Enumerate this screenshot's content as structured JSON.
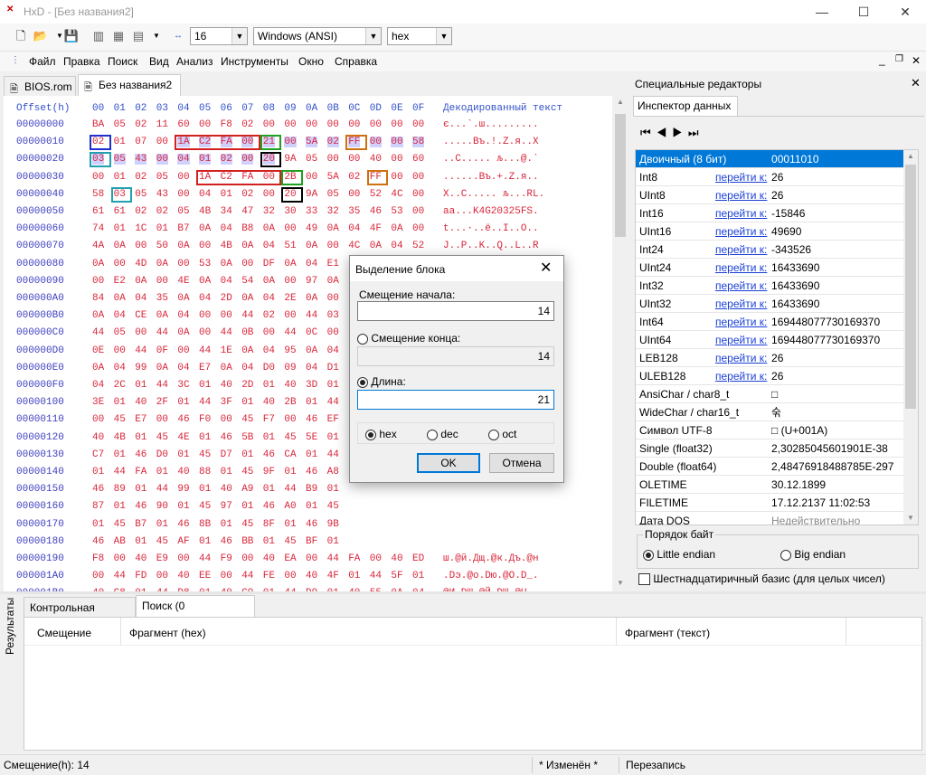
{
  "window": {
    "title": "HxD - [Без названия2]",
    "logo": "HxD",
    "minimize": "—",
    "maximize": "☐",
    "close": "✕"
  },
  "toolbar": {
    "bytes_per_row": "16",
    "charset": "Windows (ANSI)",
    "offset_base": "hex",
    "icons": [
      "new-icon",
      "open-icon",
      "save-icon",
      "close-file-icon",
      "ram-icon",
      "disk-icon",
      "bytes-per-row-icon"
    ]
  },
  "menu": [
    "Файл",
    "Правка",
    "Поиск",
    "Вид",
    "Анализ",
    "Инструменты",
    "Окно",
    "Справка"
  ],
  "mdi_controls": [
    "_",
    "❐",
    "✕"
  ],
  "tabs": [
    {
      "label": "BIOS.rom"
    },
    {
      "label": "Без названия2"
    }
  ],
  "hex": {
    "header_offset": "Offset(h)",
    "columns": [
      "00",
      "01",
      "02",
      "03",
      "04",
      "05",
      "06",
      "07",
      "08",
      "09",
      "0A",
      "0B",
      "0C",
      "0D",
      "0E",
      "0F"
    ],
    "header_text": "Декодированный текст",
    "rows": [
      {
        "o": "00000000",
        "b": [
          "BA",
          "05",
          "02",
          "11",
          "60",
          "00",
          "F8",
          "02",
          "00",
          "00",
          "00",
          "00",
          "00",
          "00",
          "00",
          "00"
        ],
        "t": "є...`.ш........."
      },
      {
        "o": "00000010",
        "b": [
          "02",
          "01",
          "07",
          "00",
          "1A",
          "C2",
          "FA",
          "00",
          "21",
          "00",
          "5A",
          "02",
          "FF",
          "00",
          "00",
          "58"
        ],
        "t": ".....Въ.!.Z.я..X"
      },
      {
        "o": "00000020",
        "b": [
          "03",
          "05",
          "43",
          "00",
          "04",
          "01",
          "02",
          "00",
          "20",
          "9A",
          "05",
          "00",
          "00",
          "40",
          "00",
          "60"
        ],
        "t": "..C..... љ...@.`"
      },
      {
        "o": "00000030",
        "b": [
          "00",
          "01",
          "02",
          "05",
          "00",
          "1A",
          "C2",
          "FA",
          "00",
          "2B",
          "00",
          "5A",
          "02",
          "FF",
          "00",
          "00"
        ],
        "t": "......Въ.+.Z.я.."
      },
      {
        "o": "00000040",
        "b": [
          "58",
          "03",
          "05",
          "43",
          "00",
          "04",
          "01",
          "02",
          "00",
          "20",
          "9A",
          "05",
          "00",
          "52",
          "4C",
          "00"
        ],
        "t": "X..C..... љ...RL."
      },
      {
        "o": "00000050",
        "b": [
          "61",
          "61",
          "02",
          "02",
          "05",
          "4B",
          "34",
          "47",
          "32",
          "30",
          "33",
          "32",
          "35",
          "46",
          "53",
          "00"
        ],
        "t": "aa...K4G20325FS."
      },
      {
        "o": "00000060",
        "b": [
          "74",
          "01",
          "1C",
          "01",
          "B7",
          "0A",
          "04",
          "B8",
          "0A",
          "00",
          "49",
          "0A",
          "04",
          "4F",
          "0A",
          "00"
        ],
        "t": "t...·..ё..I..O.."
      },
      {
        "o": "00000070",
        "b": [
          "4A",
          "0A",
          "00",
          "50",
          "0A",
          "00",
          "4B",
          "0A",
          "04",
          "51",
          "0A",
          "00",
          "4C",
          "0A",
          "04",
          "52"
        ],
        "t": "J..P..K..Q..L..R"
      },
      {
        "o": "00000080",
        "b": [
          "0A",
          "00",
          "4D",
          "0A",
          "00",
          "53",
          "0A",
          "00",
          "DF",
          "0A",
          "04",
          "E1",
          "0A",
          "00",
          "E0",
          "0A"
        ],
        "t": "..M..S..я..б..а."
      },
      {
        "o": "00000090",
        "b": [
          "00",
          "E2",
          "0A",
          "00",
          "4E",
          "0A",
          "04",
          "54",
          "0A",
          "00",
          "97",
          "0A",
          "",
          "",
          "",
          ""
        ],
        "t": ""
      },
      {
        "o": "000000A0",
        "b": [
          "84",
          "0A",
          "04",
          "35",
          "0A",
          "04",
          "2D",
          "0A",
          "04",
          "2E",
          "0A",
          "00",
          "",
          "",
          "",
          ""
        ],
        "t": ""
      },
      {
        "o": "000000B0",
        "b": [
          "0A",
          "04",
          "CE",
          "0A",
          "04",
          "00",
          "00",
          "44",
          "02",
          "00",
          "44",
          "03",
          "",
          "",
          "",
          ""
        ],
        "t": ""
      },
      {
        "o": "000000C0",
        "b": [
          "44",
          "05",
          "00",
          "44",
          "0A",
          "00",
          "44",
          "0B",
          "00",
          "44",
          "0C",
          "00",
          "",
          "",
          "",
          ""
        ],
        "t": ""
      },
      {
        "o": "000000D0",
        "b": [
          "0E",
          "00",
          "44",
          "0F",
          "00",
          "44",
          "1E",
          "0A",
          "04",
          "95",
          "0A",
          "04",
          "",
          "",
          "",
          ""
        ],
        "t": ""
      },
      {
        "o": "000000E0",
        "b": [
          "0A",
          "04",
          "99",
          "0A",
          "04",
          "E7",
          "0A",
          "04",
          "D0",
          "09",
          "04",
          "D1",
          "",
          "",
          "",
          ""
        ],
        "t": ""
      },
      {
        "o": "000000F0",
        "b": [
          "04",
          "2C",
          "01",
          "44",
          "3C",
          "01",
          "40",
          "2D",
          "01",
          "40",
          "3D",
          "01",
          "",
          "",
          "",
          ""
        ],
        "t": ""
      },
      {
        "o": "00000100",
        "b": [
          "3E",
          "01",
          "40",
          "2F",
          "01",
          "44",
          "3F",
          "01",
          "40",
          "2B",
          "01",
          "44",
          "",
          "",
          "",
          ""
        ],
        "t": ""
      },
      {
        "o": "00000110",
        "b": [
          "00",
          "45",
          "E7",
          "00",
          "46",
          "F0",
          "00",
          "45",
          "F7",
          "00",
          "46",
          "EF",
          "",
          "",
          "",
          ""
        ],
        "t": ""
      },
      {
        "o": "00000120",
        "b": [
          "40",
          "4B",
          "01",
          "45",
          "4E",
          "01",
          "46",
          "5B",
          "01",
          "45",
          "5E",
          "01",
          "",
          "",
          "",
          ""
        ],
        "t": ""
      },
      {
        "o": "00000130",
        "b": [
          "C7",
          "01",
          "46",
          "D0",
          "01",
          "45",
          "D7",
          "01",
          "46",
          "CA",
          "01",
          "44",
          "",
          "",
          "",
          ""
        ],
        "t": ""
      },
      {
        "o": "00000140",
        "b": [
          "01",
          "44",
          "FA",
          "01",
          "40",
          "88",
          "01",
          "45",
          "9F",
          "01",
          "46",
          "A8",
          "",
          "",
          "",
          ""
        ],
        "t": ""
      },
      {
        "o": "00000150",
        "b": [
          "46",
          "89",
          "01",
          "44",
          "99",
          "01",
          "40",
          "A9",
          "01",
          "44",
          "B9",
          "01",
          "",
          "",
          "",
          ""
        ],
        "t": ""
      },
      {
        "o": "00000160",
        "b": [
          "87",
          "01",
          "46",
          "90",
          "01",
          "45",
          "97",
          "01",
          "46",
          "A0",
          "01",
          "45",
          "",
          "",
          "",
          ""
        ],
        "t": ""
      },
      {
        "o": "00000170",
        "b": [
          "01",
          "45",
          "B7",
          "01",
          "46",
          "8B",
          "01",
          "45",
          "8F",
          "01",
          "46",
          "9B",
          "",
          "",
          "",
          ""
        ],
        "t": ""
      },
      {
        "o": "00000180",
        "b": [
          "46",
          "AB",
          "01",
          "45",
          "AF",
          "01",
          "46",
          "BB",
          "01",
          "45",
          "BF",
          "01",
          "",
          "",
          "",
          ""
        ],
        "t": ""
      },
      {
        "o": "00000190",
        "b": [
          "F8",
          "00",
          "40",
          "E9",
          "00",
          "44",
          "F9",
          "00",
          "40",
          "EA",
          "00",
          "44",
          "FA",
          "00",
          "40",
          "ED"
        ],
        "t": "ш.@й.Дщ.@к.Дъ.@н"
      },
      {
        "o": "000001A0",
        "b": [
          "00",
          "44",
          "FD",
          "00",
          "40",
          "EE",
          "00",
          "44",
          "FE",
          "00",
          "40",
          "4F",
          "01",
          "44",
          "5F",
          "01"
        ],
        "t": ".Dэ.@о.Dю.@O.D_."
      },
      {
        "o": "000001B0",
        "b": [
          "40",
          "C8",
          "01",
          "44",
          "D8",
          "01",
          "40",
          "C9",
          "01",
          "44",
          "D9",
          "01",
          "40",
          "55",
          "0A",
          "04"
        ],
        "t": "@И.DШ.@Й.DЩ.@U.."
      },
      {
        "o": "000001C0",
        "b": [
          "56",
          "0A",
          "00",
          "DD",
          "0A",
          "04",
          "DE",
          "0A",
          "00",
          "40",
          "01",
          "45",
          "4A",
          "01",
          "46",
          "50"
        ],
        "t": "V..Э..Ю..@.EJ.FP"
      },
      {
        "o": "000001D0",
        "b": [
          "01",
          "45",
          "5A",
          "01",
          "46",
          "FF",
          "FF",
          "FF",
          "FF",
          "FF",
          "01",
          "00",
          "00",
          "00",
          "00",
          "00"
        ],
        "t": ".EZ.Fяяяяя......"
      },
      {
        "o": "000001E0",
        "b": [
          "62",
          "04",
          "07",
          "00",
          "60",
          "04",
          "87",
          "00",
          "4E",
          "11",
          "49",
          "34",
          "33",
          "31",
          "03",
          "00"
        ],
        "t": "b.....`.‡.N.I431.."
      },
      {
        "o": "000001F0",
        "b": [
          "24",
          "49",
          "92",
          "00",
          "2C",
          "8B",
          "02",
          "00",
          "09",
          "04",
          "00",
          "00",
          "15",
          "62",
          "44",
          "00"
        ],
        "t": "$I’.,‹.......bD."
      },
      {
        "o": "00000200",
        "b": [
          "",
          "",
          "",
          "",
          "",
          "",
          "",
          "",
          "",
          "",
          "",
          "",
          "",
          "",
          "",
          ""
        ],
        "t": ""
      }
    ]
  },
  "dialog": {
    "title": "Выделение блока",
    "start_label": "Смещение начала:",
    "start_value": "14",
    "end_label": "Смещение конца:",
    "end_value": "14",
    "length_label": "Длина:",
    "length_value": "21",
    "radio_hex": "hex",
    "radio_dec": "dec",
    "radio_oct": "oct",
    "ok": "OK",
    "cancel": "Отмена"
  },
  "right_panel": {
    "title": "Специальные редакторы",
    "tab": "Инспектор данных",
    "nav_icons": [
      "first-icon",
      "prev-icon",
      "next-icon",
      "last-icon"
    ],
    "rows": [
      {
        "type": "Двоичный (8 бит)",
        "link": "",
        "value": "00011010",
        "selected": true
      },
      {
        "type": "Int8",
        "link": "перейти к:",
        "value": "26"
      },
      {
        "type": "UInt8",
        "link": "перейти к:",
        "value": "26"
      },
      {
        "type": "Int16",
        "link": "перейти к:",
        "value": "-15846"
      },
      {
        "type": "UInt16",
        "link": "перейти к:",
        "value": "49690"
      },
      {
        "type": "Int24",
        "link": "перейти к:",
        "value": "-343526"
      },
      {
        "type": "UInt24",
        "link": "перейти к:",
        "value": "16433690"
      },
      {
        "type": "Int32",
        "link": "перейти к:",
        "value": "16433690"
      },
      {
        "type": "UInt32",
        "link": "перейти к:",
        "value": "16433690"
      },
      {
        "type": "Int64",
        "link": "перейти к:",
        "value": "169448077730169370"
      },
      {
        "type": "UInt64",
        "link": "перейти к:",
        "value": "169448077730169370"
      },
      {
        "type": "LEB128",
        "link": "перейти к:",
        "value": "26"
      },
      {
        "type": "ULEB128",
        "link": "перейти к:",
        "value": "26"
      },
      {
        "type": "AnsiChar / char8_t",
        "link": "",
        "value": "□"
      },
      {
        "type": "WideChar / char16_t",
        "link": "",
        "value": "숚"
      },
      {
        "type": "Символ UTF-8",
        "link": "",
        "value": "□ (U+001A)"
      },
      {
        "type": "Single (float32)",
        "link": "",
        "value": "2,30285045601901E-38"
      },
      {
        "type": "Double (float64)",
        "link": "",
        "value": "2,48476918488785E-297"
      },
      {
        "type": "OLETIME",
        "link": "",
        "value": "30.12.1899"
      },
      {
        "type": "FILETIME",
        "link": "",
        "value": "17.12.2137 11:02:53"
      },
      {
        "type": "Дата DOS",
        "link": "",
        "value": "Недействительно",
        "grey": true
      },
      {
        "type": "Время DOS",
        "link": "",
        "value": "Недействительно",
        "grey": true
      }
    ],
    "byte_order_label": "Порядок байт",
    "little_endian": "Little endian",
    "big_endian": "Big endian",
    "hex_basis": "Шестнадцатиричный базис (для целых чисел)"
  },
  "results": {
    "side_label": "Результаты",
    "tabs": [
      "Контрольная сумма",
      "Поиск (0 совпадений)"
    ],
    "columns": [
      "Смещение",
      "Фрагмент (hex)",
      "Фрагмент (текст)"
    ]
  },
  "status": {
    "offset": "Смещение(h): 14",
    "modified": "* Изменён *",
    "mode": "Перезапись"
  },
  "colors": {
    "hex_red": "#d9263a",
    "header_blue": "#3050c8",
    "selection_blue": "#0078d7",
    "box_blue": "#2030d0",
    "box_red": "#d02020",
    "box_green": "#20a020",
    "box_orange": "#d07010",
    "box_black": "#000000",
    "box_teal": "#20a0b0"
  }
}
